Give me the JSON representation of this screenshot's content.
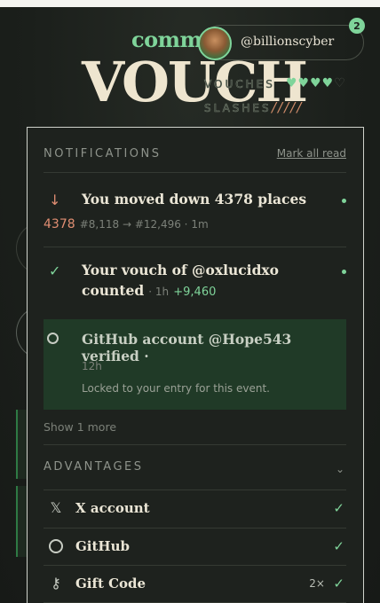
{
  "header": {
    "brand": "comm",
    "username": "@billionscyber",
    "notification_count": "2",
    "title": "VOUCH",
    "vouches_label": "VOUCHES",
    "hearts_filled": "♥♥♥♥",
    "hearts_empty": "♡",
    "slashes_label": "SLASHES",
    "slash_marks": "/////"
  },
  "notifications": {
    "heading": "NOTIFICATIONS",
    "mark_all_read": "Mark all read",
    "items": [
      {
        "icon": "arrow-down-icon",
        "icon_glyph": "↓",
        "title": "You moved down 4378 places",
        "delta": "4378",
        "detail": "#8,118 → #12,496 · 1m"
      },
      {
        "icon": "check-icon",
        "icon_glyph": "✓",
        "title_line1": "Your vouch of @oxlucidxo",
        "title_line2": "counted",
        "time": "· 1h",
        "points": "+9,460"
      },
      {
        "icon": "github-icon",
        "title": "GitHub account @Hope543 verified ·",
        "time": "12h",
        "description": "Locked to your entry for this event."
      }
    ],
    "show_more": "Show 1 more"
  },
  "advantages": {
    "heading": "ADVANTAGES",
    "items": [
      {
        "icon": "x-logo-icon",
        "glyph": "𝕏",
        "label": "X account",
        "multiplier": "",
        "verified": true
      },
      {
        "icon": "github-icon",
        "glyph": "",
        "label": "GitHub",
        "multiplier": "",
        "verified": true
      },
      {
        "icon": "key-icon",
        "glyph": "⚷",
        "label": "Gift Code",
        "multiplier": "2×",
        "verified": true
      }
    ]
  },
  "colors": {
    "accent_green": "#7fd49a",
    "down_orange": "#e08e72",
    "background": "#1d211d",
    "highlight_row": "#203a27"
  }
}
